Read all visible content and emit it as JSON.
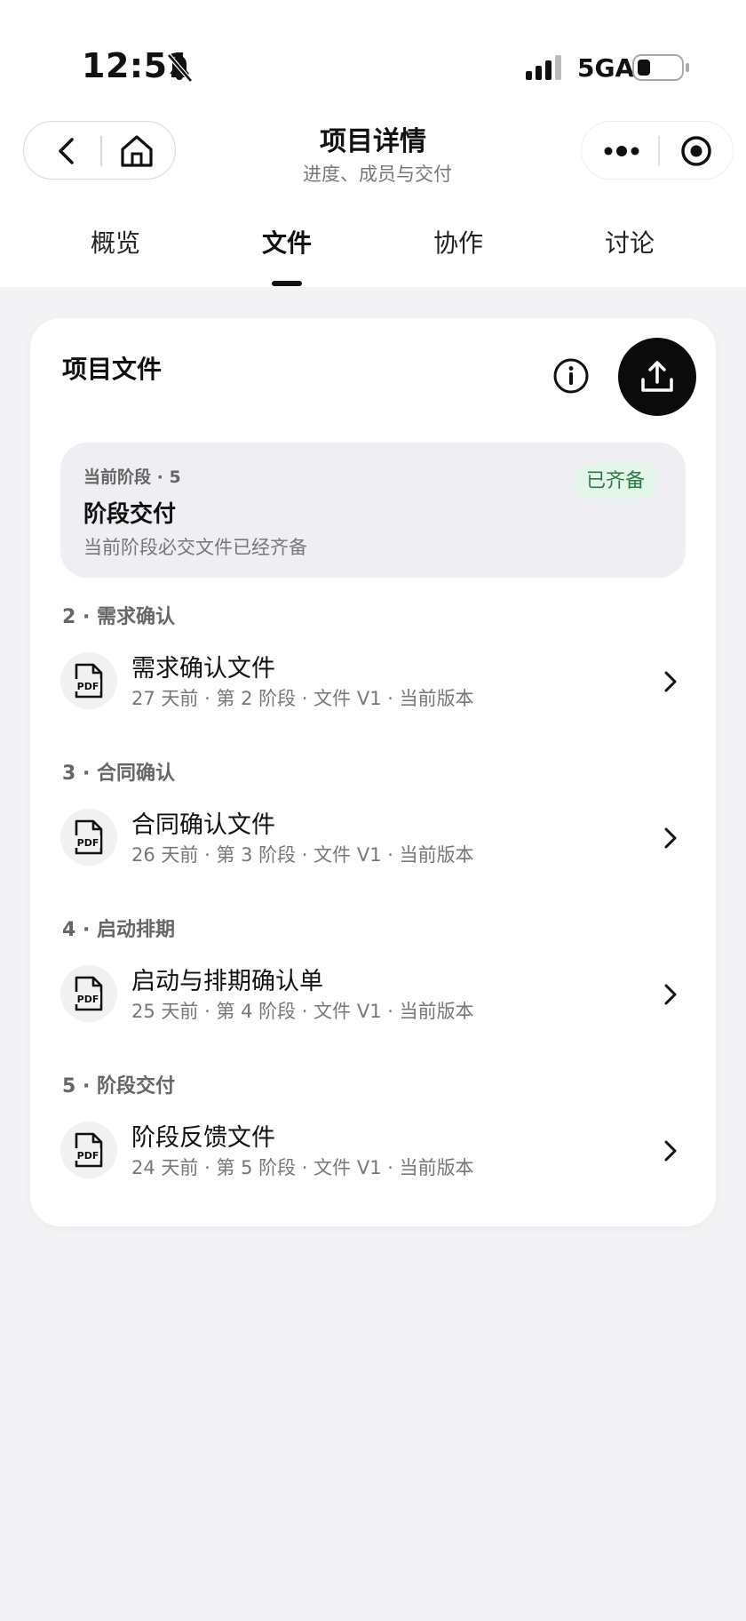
{
  "status_bar": {
    "time": "12:51",
    "network": "5GA"
  },
  "nav": {
    "title": "项目详情",
    "subtitle": "进度、成员与交付"
  },
  "tabs": [
    {
      "label": "概览"
    },
    {
      "label": "文件",
      "active": true
    },
    {
      "label": "协作"
    },
    {
      "label": "讨论"
    }
  ],
  "card": {
    "title": "项目文件",
    "stage": {
      "label": "当前阶段 · 5",
      "name": "阶段交付",
      "description": "当前阶段必交文件已经齐备",
      "badge": "已齐备"
    },
    "groups": [
      {
        "title": "2 · 需求确认",
        "file": {
          "name": "需求确认文件",
          "meta": "27 天前 · 第 2 阶段 · 文件 V1 · 当前版本"
        }
      },
      {
        "title": "3 · 合同确认",
        "file": {
          "name": "合同确认文件",
          "meta": "26 天前 · 第 3 阶段 · 文件 V1 · 当前版本"
        }
      },
      {
        "title": "4 · 启动排期",
        "file": {
          "name": "启动与排期确认单",
          "meta": "25 天前 · 第 4 阶段 · 文件 V1 · 当前版本"
        }
      },
      {
        "title": "5 · 阶段交付",
        "file": {
          "name": "阶段反馈文件",
          "meta": "24 天前 · 第 5 阶段 · 文件 V1 · 当前版本"
        }
      }
    ],
    "file_icon": "pdf-file-icon"
  },
  "colors": {
    "page_bg": "#f3f3f6",
    "accent_dark": "#0b0b0b",
    "badge_bg": "#e4f6ea",
    "badge_text": "#2b7a45"
  }
}
